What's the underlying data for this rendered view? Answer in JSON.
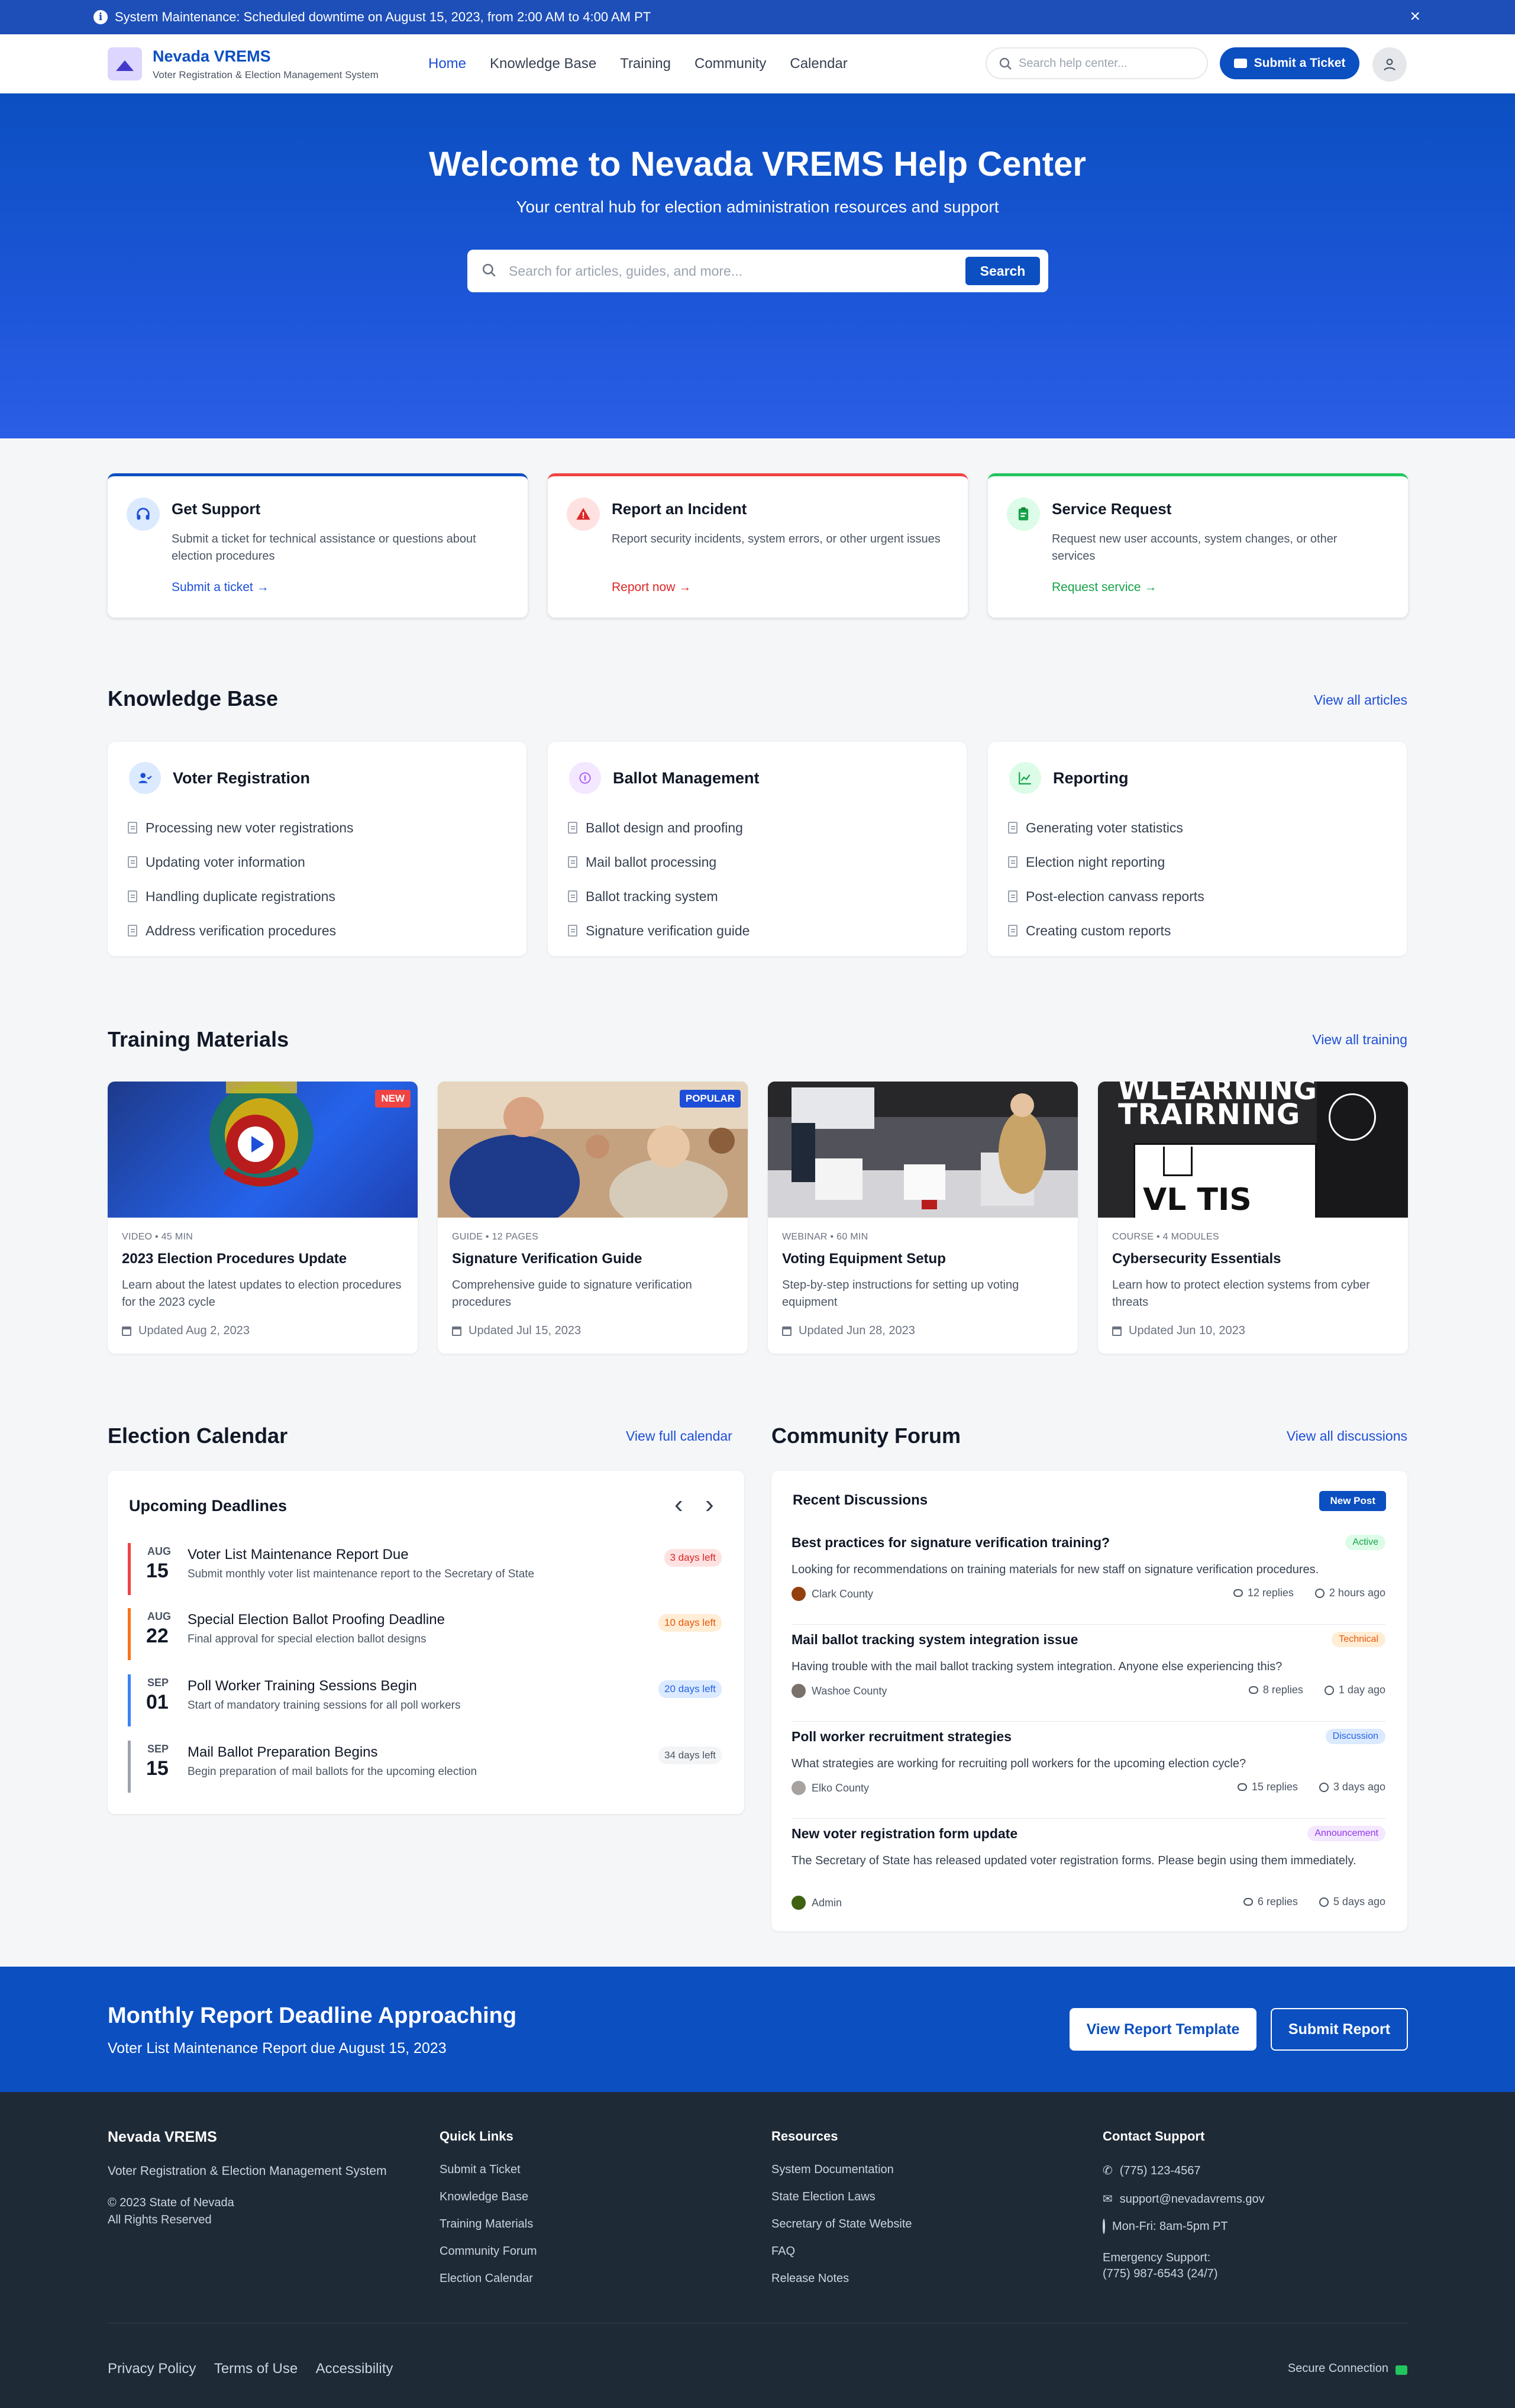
{
  "maintenance": {
    "text": "System Maintenance: Scheduled downtime on August 15, 2023, from 2:00 AM to 4:00 AM PT",
    "close": "×"
  },
  "header": {
    "brand": "Nevada VREMS",
    "subtitle": "Voter Registration & Election Management System",
    "nav": [
      "Home",
      "Knowledge Base",
      "Training",
      "Community",
      "Calendar"
    ],
    "search_placeholder": "Search help center...",
    "ticket_button": "Submit a Ticket"
  },
  "hero": {
    "title": "Welcome to Nevada VREMS Help Center",
    "subtitle": "Your central hub for election administration resources and support",
    "search_placeholder": "Search for articles, guides, and more...",
    "search_button": "Search"
  },
  "actions": [
    {
      "title": "Get Support",
      "desc": "Submit a ticket for technical assistance or questions about election procedures",
      "link": "Submit a ticket",
      "color": "#0b4fc1"
    },
    {
      "title": "Report an Incident",
      "desc": "Report security incidents, system errors, or other urgent issues",
      "link": "Report now",
      "color": "#ef4444"
    },
    {
      "title": "Service Request",
      "desc": "Request new user accounts, system changes, or other services",
      "link": "Request service",
      "color": "#22c55e"
    }
  ],
  "knowledge_base": {
    "title": "Knowledge Base",
    "view_all": "View all articles",
    "categories": [
      {
        "title": "Voter Registration",
        "items": [
          "Processing new voter registrations",
          "Updating voter information",
          "Handling duplicate registrations",
          "Address verification procedures"
        ]
      },
      {
        "title": "Ballot Management",
        "items": [
          "Ballot design and proofing",
          "Mail ballot processing",
          "Ballot tracking system",
          "Signature verification guide"
        ]
      },
      {
        "title": "Reporting",
        "items": [
          "Generating voter statistics",
          "Election night reporting",
          "Post-election canvass reports",
          "Creating custom reports"
        ]
      }
    ]
  },
  "training": {
    "title": "Training Materials",
    "view_all": "View all training",
    "items": [
      {
        "badge": "NEW",
        "meta": "VIDEO • 45 MIN",
        "title": "2023 Election Procedures Update",
        "desc": "Learn about the latest updates to election procedures for the 2023 cycle",
        "updated": "Updated Aug 2, 2023"
      },
      {
        "badge": "POPULAR",
        "meta": "GUIDE • 12 PAGES",
        "title": "Signature Verification Guide",
        "desc": "Comprehensive guide to signature verification procedures",
        "updated": "Updated Jul 15, 2023"
      },
      {
        "badge": "",
        "meta": "WEBINAR • 60 MIN",
        "title": "Voting Equipment Setup",
        "desc": "Step-by-step instructions for setting up voting equipment",
        "updated": "Updated Jun 28, 2023"
      },
      {
        "badge": "",
        "meta": "COURSE • 4 MODULES",
        "title": "Cybersecurity Essentials",
        "desc": "Learn how to protect election systems from cyber threats",
        "updated": "Updated Jun 10, 2023",
        "image_text": [
          "WLEARNING",
          "TRAIRNING",
          "VL TIS"
        ]
      }
    ]
  },
  "calendar": {
    "title": "Election Calendar",
    "view_all": "View full calendar",
    "panel_title": "Upcoming Deadlines",
    "prev": "‹",
    "next": "›",
    "deadlines": [
      {
        "month": "AUG",
        "day": "15",
        "title": "Voter List Maintenance Report Due",
        "desc": "Submit monthly voter list maintenance report to the Secretary of State",
        "left": "3 days left",
        "color": "#ef4444"
      },
      {
        "month": "AUG",
        "day": "22",
        "title": "Special Election Ballot Proofing Deadline",
        "desc": "Final approval for special election ballot designs",
        "left": "10 days left",
        "color": "#f97316"
      },
      {
        "month": "SEP",
        "day": "01",
        "title": "Poll Worker Training Sessions Begin",
        "desc": "Start of mandatory training sessions for all poll workers",
        "left": "20 days left",
        "color": "#3b82f6"
      },
      {
        "month": "SEP",
        "day": "15",
        "title": "Mail Ballot Preparation Begins",
        "desc": "Begin preparation of mail ballots for the upcoming election",
        "left": "34 days left",
        "color": "#9ca3af"
      }
    ]
  },
  "forum": {
    "title": "Community Forum",
    "view_all": "View all discussions",
    "panel_title": "Recent Discussions",
    "new_post": "New Post",
    "posts": [
      {
        "title": "Best practices for signature verification training?",
        "tag": "Active",
        "desc": "Looking for recommendations on training materials for new staff on signature verification procedures.",
        "author": "Clark County",
        "replies": "12 replies",
        "time": "2 hours ago"
      },
      {
        "title": "Mail ballot tracking system integration issue",
        "tag": "Technical",
        "desc": "Having trouble with the mail ballot tracking system integration. Anyone else experiencing this?",
        "author": "Washoe County",
        "replies": "8 replies",
        "time": "1 day ago"
      },
      {
        "title": "Poll worker recruitment strategies",
        "tag": "Discussion",
        "desc": "What strategies are working for recruiting poll workers for the upcoming election cycle?",
        "author": "Elko County",
        "replies": "15 replies",
        "time": "3 days ago"
      },
      {
        "title": "New voter registration form update",
        "tag": "Announcement",
        "desc": "The Secretary of State has released updated voter registration forms. Please begin using them immediately.",
        "author": "Admin",
        "replies": "6 replies",
        "time": "5 days ago"
      }
    ]
  },
  "cta": {
    "title": "Monthly Report Deadline Approaching",
    "subtitle": "Voter List Maintenance Report due August 15, 2023",
    "template_button": "View Report Template",
    "submit_button": "Submit Report"
  },
  "footer": {
    "brand": "Nevada VREMS",
    "brand_sub": "Voter Registration & Election Management System",
    "copyright": "© 2023 State of Nevada",
    "rights": "All Rights Reserved",
    "quick_links_title": "Quick Links",
    "quick_links": [
      "Submit a Ticket",
      "Knowledge Base",
      "Training Materials",
      "Community Forum",
      "Election Calendar"
    ],
    "resources_title": "Resources",
    "resources": [
      "System Documentation",
      "State Election Laws",
      "Secretary of State Website",
      "FAQ",
      "Release Notes"
    ],
    "contact_title": "Contact Support",
    "phone": "(775) 123-4567",
    "email": "support@nevadavrems.gov",
    "hours": "Mon-Fri: 8am-5pm PT",
    "emergency_label": "Emergency Support:",
    "emergency_phone": "(775) 987-6543 (24/7)",
    "bottom_links": [
      "Privacy Policy",
      "Terms of Use",
      "Accessibility"
    ],
    "secure": "Secure Connection"
  }
}
